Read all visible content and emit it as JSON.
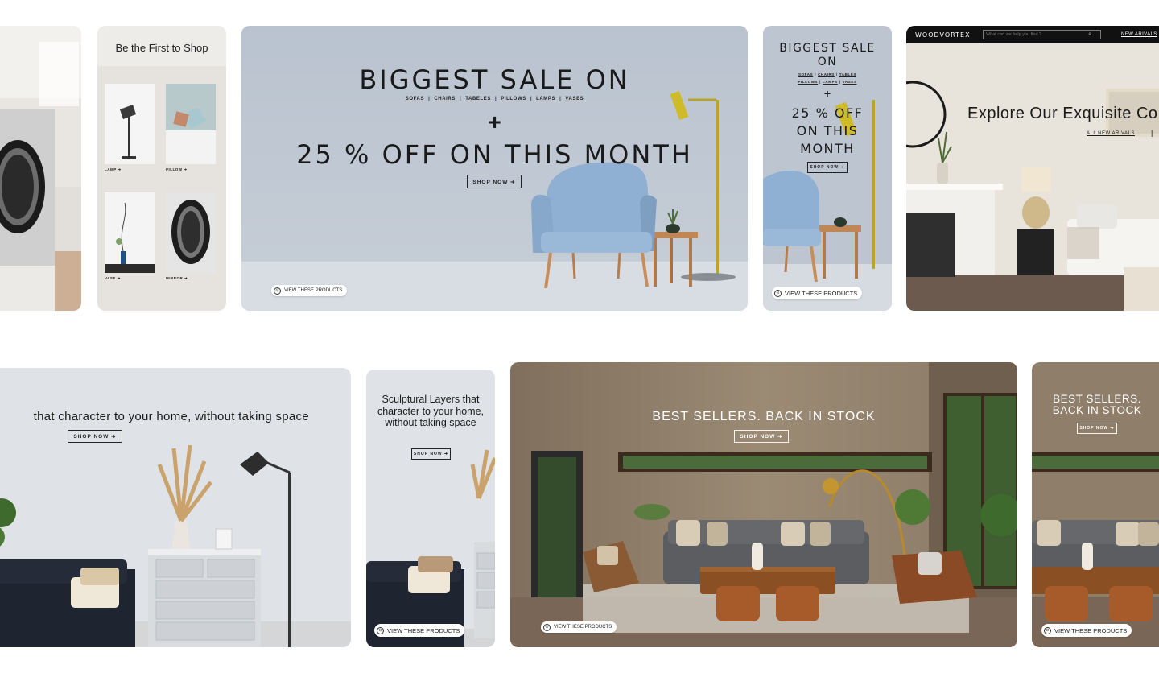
{
  "colors": {
    "page_bg": "#ffffff",
    "text_dark": "#1a1a1a",
    "nav_bg": "#111111",
    "chair_blue": "#8fb0d2",
    "lamp_yellow": "#c9b531"
  },
  "icons": [
    "arrow-right-icon",
    "bag-icon",
    "search-icon"
  ],
  "row1": {
    "product_grid_card": {
      "heading": "Be the First to Shop",
      "labels": [
        "LAMP ➜",
        "PILLOW ➜",
        "VASE ➜",
        "MIRROR ➜"
      ]
    },
    "sale_banner": {
      "headline": "BIGGEST SALE ON",
      "categories": [
        "SOFAS",
        "CHAIRS",
        "TABELES",
        "PILLOWS",
        "LAMPS",
        "VASES"
      ],
      "plus": "+",
      "offer": "25 % OFF ON THIS MONTH",
      "shop_now": "SHOP NOW ➜",
      "view_products": "VIEW THESE PRODUCTS"
    },
    "sale_mobile": {
      "headline": "BIGGEST SALE ON",
      "categories_line1": [
        "SOFAS",
        "CHAIRS",
        "TABLES"
      ],
      "categories_line2": [
        "PILLOWS",
        "LAMPS",
        "VASES"
      ],
      "plus": "+",
      "offer": "25 % OFF ON THIS MONTH",
      "shop_now": "SHOP NOW ➜",
      "view_products": "VIEW THESE PRODUCTS"
    },
    "web_banner": {
      "brand": "WOODVORTEX",
      "search_placeholder": "What can we help you find ?",
      "nav_link": "NEW ARIVALS",
      "headline": "Explore Our Exquisite Co",
      "link": "ALL NEW ARIVALS",
      "divider": "|"
    }
  },
  "row2": {
    "character_banner": {
      "headline": "that character to your home, without taking space",
      "shop_now": "SHOP NOW ➜"
    },
    "sculptural_card": {
      "headline": "Sculptural Layers that character to your home, without taking space",
      "shop_now": "SHOP NOW ➜",
      "view_products": "VIEW THESE PRODUCTS"
    },
    "bestsellers_banner": {
      "headline": "BEST SELLERS. BACK IN STOCK",
      "shop_now": "SHOP NOW ➜",
      "view_products": "VIEW THESE PRODUCTS"
    },
    "bestsellers_mobile": {
      "headline": "BEST SELLERS. BACK IN STOCK",
      "shop_now": "SHOP NOW ➜",
      "view_products": "VIEW THESE PRODUCTS"
    }
  }
}
